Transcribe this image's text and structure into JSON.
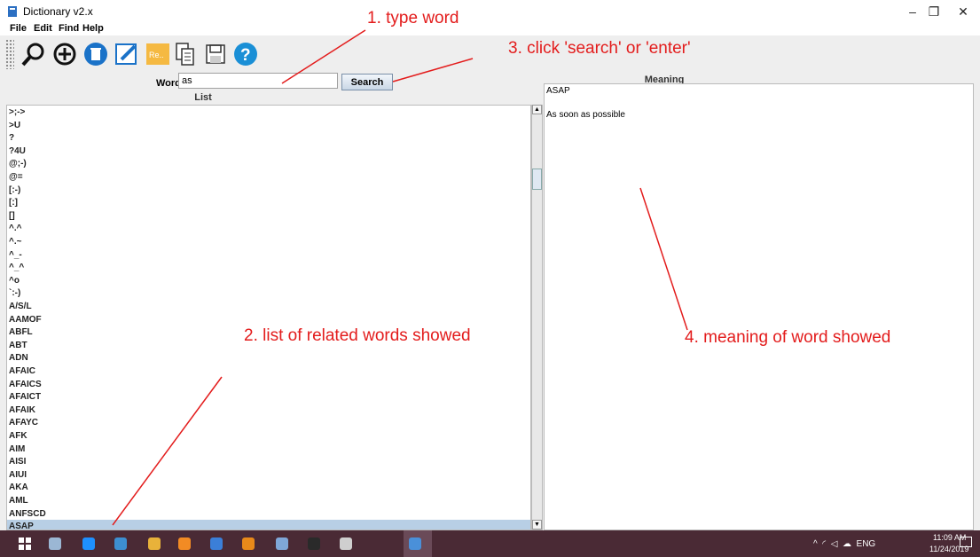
{
  "window": {
    "title": "Dictionary v2.x",
    "minimize": "–",
    "restore": "❐",
    "close": "✕",
    "icon": "book-icon"
  },
  "menu": [
    "File",
    "Edit",
    "Find",
    "Help"
  ],
  "toolbar": {
    "icons": [
      "search-icon",
      "add-icon",
      "delete-icon",
      "edit-icon",
      "rename-icon",
      "copy-icon",
      "save-icon",
      "help-icon"
    ],
    "rename_label": "Re.."
  },
  "search": {
    "label": "Word",
    "value": "as",
    "button": "Search"
  },
  "list": {
    "header": "List",
    "items": [
      ">;->",
      ">U",
      "?",
      "?4U",
      "@;-)",
      "@=",
      "[:-)",
      "[:]",
      "[]",
      "^.^",
      "^.~",
      "^_-",
      "^_^",
      "^o",
      "`:-)",
      "A/S/L",
      "AAMOF",
      "ABFL",
      "ABT",
      "ADN",
      "AFAIC",
      "AFAICS",
      "AFAICT",
      "AFAIK",
      "AFAYC",
      "AFK",
      "AIM",
      "AISI",
      "AIUI",
      "AKA",
      "AML",
      "ANFSCD",
      "ASAP"
    ],
    "selected_index": 32
  },
  "meaning": {
    "header": "Meaning",
    "word": "ASAP",
    "definition": "As soon as possible"
  },
  "annotations": {
    "step1": "1. type word",
    "step2": "2. list of related words showed",
    "step3": "3. click 'search' or 'enter'",
    "step4": "4. meaning of word showed"
  },
  "taskbar": {
    "icons": [
      "windows-start-icon",
      "file-explorer-icon",
      "edge-icon",
      "files-icon",
      "chrome-icon",
      "app-icon",
      "word-icon",
      "sublime-icon",
      "notepad-icon",
      "terminal-icon",
      "paint-icon",
      "dictionary-icon"
    ],
    "language": "ENG",
    "time": "11:09 AM",
    "date": "11/24/2019"
  },
  "colors": {
    "annotation": "#e31c1c",
    "selection": "#b8cfe5",
    "taskbar": "#4a2a35"
  }
}
